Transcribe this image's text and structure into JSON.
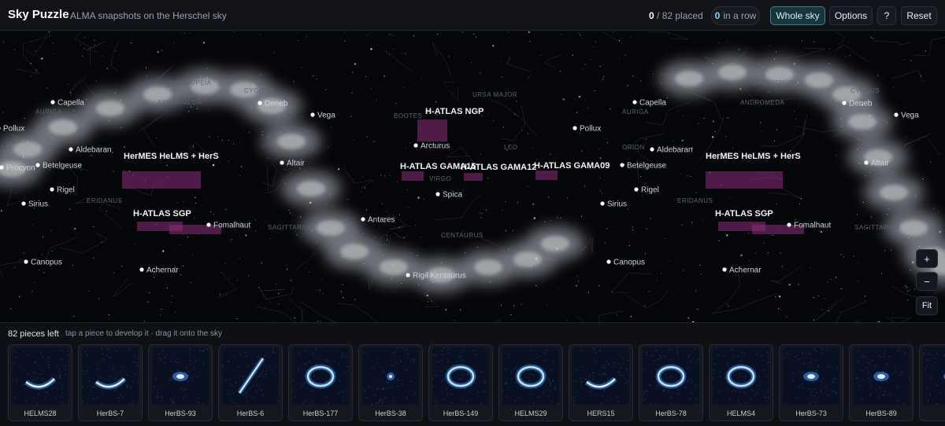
{
  "header": {
    "title": "Sky Puzzle",
    "subtitle": "ALMA snapshots on the Herschel sky",
    "placed_count": "0",
    "placed_total": "/ 82 placed",
    "streak_count": "0",
    "streak_label": "in a row",
    "whole_sky_label": "Whole sky",
    "options_label": "Options",
    "help_label": "?",
    "reset_label": "Reset"
  },
  "map": {
    "zoom_in_label": "+",
    "zoom_out_label": "−",
    "fit_label": "Fit",
    "fields": [
      {
        "label": "HerMES HeLMS + HerS"
      },
      {
        "label": "H-ATLAS SGP"
      },
      {
        "label": "H-ATLAS NGP"
      },
      {
        "label": "H-ATLAS GAMA15"
      },
      {
        "label": "H-ATLAS GAMA12"
      },
      {
        "label": "H-ATLAS GAMA09"
      },
      {
        "label": "HerMES HeLMS + HerS"
      },
      {
        "label": "H-ATLAS SGP"
      }
    ],
    "stars": [
      "Capella",
      "Deneb",
      "Vega",
      "Pollux",
      "Aldebaran",
      "Procyon",
      "Betelgeuse",
      "Altair",
      "Rigel",
      "Sirius",
      "Fomalhaut",
      "Canopus",
      "Achernar",
      "Arcturus",
      "Spica",
      "Antares",
      "Rigil Kentaurus",
      "Capella",
      "Deneb",
      "Vega",
      "Pollux",
      "Aldebaran",
      "Betelgeuse",
      "Altair",
      "Rigel",
      "Sirius",
      "Fomalhaut",
      "Canopus",
      "Achernar"
    ],
    "constellations": [
      "CASSIOPEIA",
      "ANDROMEDA",
      "CYGNUS",
      "AURIGA",
      "URSA MAJOR",
      "BOOTES",
      "LEO",
      "VIRGO",
      "ERIDANUS",
      "SAGITTARIUS",
      "CENTAURUS",
      "CASSIOPEIA",
      "ANDROMEDA",
      "CYGNUS",
      "AURIGA",
      "ORION",
      "ERIDANUS",
      "SAGITTARIUS"
    ]
  },
  "tray": {
    "count_label": "82 pieces left",
    "hint": "tap a piece to develop it · drag it onto the sky",
    "pieces": [
      {
        "name": "HELMS28",
        "shape": "arc"
      },
      {
        "name": "HerBS-7",
        "shape": "arc"
      },
      {
        "name": "HerBS-93",
        "shape": "blob"
      },
      {
        "name": "HerBS-6",
        "shape": "streak"
      },
      {
        "name": "HerBS-177",
        "shape": "ring"
      },
      {
        "name": "HerBS-38",
        "shape": "dot"
      },
      {
        "name": "HerBS-149",
        "shape": "ring"
      },
      {
        "name": "HELMS29",
        "shape": "ring"
      },
      {
        "name": "HERS15",
        "shape": "arc"
      },
      {
        "name": "HerBS-78",
        "shape": "ring"
      },
      {
        "name": "HELMS4",
        "shape": "ring"
      },
      {
        "name": "HerBS-73",
        "shape": "blob"
      },
      {
        "name": "HerBS-89",
        "shape": "blob"
      },
      {
        "name": "He",
        "shape": "blob"
      }
    ]
  },
  "colors": {
    "field": "#8a2f7a",
    "star_label": "#cfd4dc",
    "accent": "#3f7e86"
  }
}
